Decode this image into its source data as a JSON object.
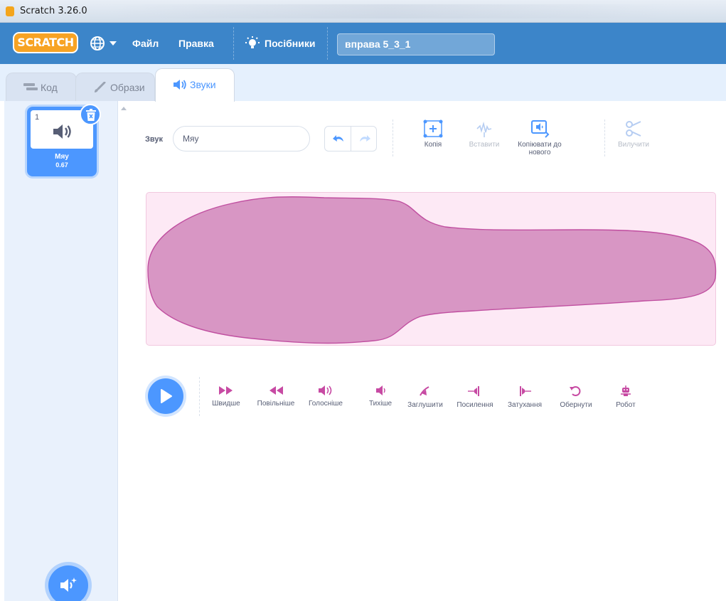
{
  "window": {
    "title": "Scratch 3.26.0"
  },
  "menubar": {
    "logo": "SCRATCH",
    "file": "Файл",
    "edit": "Правка",
    "tutorials": "Посібники",
    "project_title": "вправа 5_3_1"
  },
  "tabs": [
    {
      "label": "Код",
      "icon": "code-icon"
    },
    {
      "label": "Образи",
      "icon": "brush-icon"
    },
    {
      "label": "Звуки",
      "icon": "speaker-icon",
      "active": true
    }
  ],
  "sound_list": [
    {
      "number": "1",
      "name": "Мяу",
      "duration": "0.67",
      "selected": true
    }
  ],
  "editor": {
    "sound_label": "Звук",
    "sound_name": "Мяу",
    "tools": {
      "copy": "Копія",
      "paste": "Вставити",
      "copy_new": "Копіювати до нового",
      "delete": "Вилучити"
    }
  },
  "effects": [
    {
      "label": "Швидше",
      "icon": "faster-icon"
    },
    {
      "label": "Повільніше",
      "icon": "slower-icon"
    },
    {
      "label": "Голосніше",
      "icon": "louder-icon"
    },
    {
      "label": "Тихіше",
      "icon": "softer-icon"
    },
    {
      "label": "Заглушити",
      "icon": "mute-icon"
    },
    {
      "label": "Посилення",
      "icon": "fade-in-icon"
    },
    {
      "label": "Затухання",
      "icon": "fade-out-icon"
    },
    {
      "label": "Обернути",
      "icon": "reverse-icon"
    },
    {
      "label": "Робот",
      "icon": "robot-icon"
    }
  ],
  "colors": {
    "accent": "#4c97ff",
    "menubar": "#3c85c9",
    "sound_pink": "#cf63cf",
    "effect_icon": "#c74aa3"
  }
}
